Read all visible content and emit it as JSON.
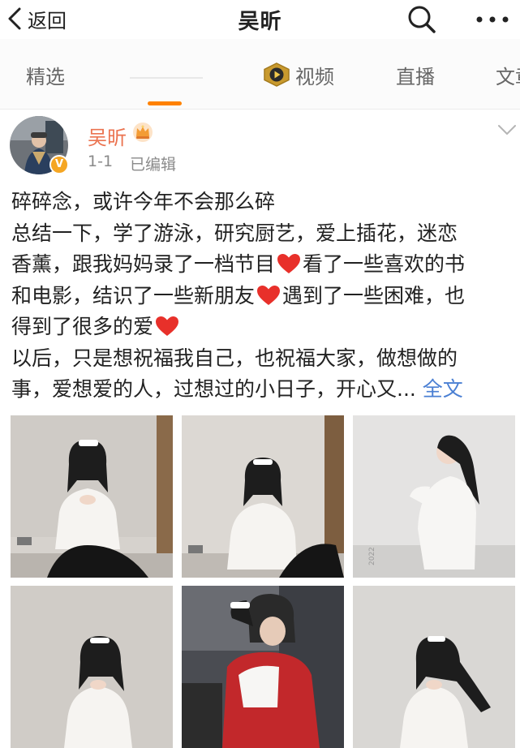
{
  "topbar": {
    "back_label": "返回",
    "title": "吴昕"
  },
  "tabs": [
    {
      "label": "精选"
    },
    {
      "label": "视频",
      "icon": "video-play-icon"
    },
    {
      "label": "直播"
    },
    {
      "label": "文章"
    }
  ],
  "post": {
    "author": "吴昕",
    "badge": "V",
    "time": "1-1",
    "edited": "已编辑",
    "lines": [
      "碎碎念，或许今年不会那么碎",
      "总结一下，学了游泳，研究厨艺，爱上插花，迷恋",
      "香薰，跟我妈妈录了一档节目",
      "看了一些喜欢的书",
      "和电影，结识了一些新朋友",
      "遇到了一些困难，也",
      "得到了很多的爱",
      "以后，只是想祝福我自己，也祝福大家，做想做的",
      "事，爱想爱的人，过想过的小日子，开心又..."
    ],
    "full_text_link": "全文"
  },
  "colors": {
    "accent": "#ff8200",
    "username": "#eb7350",
    "link": "#4a7fd3",
    "heart": "#e8302a"
  },
  "photos": [
    {
      "name": "photo-1",
      "stamp": ""
    },
    {
      "name": "photo-2",
      "stamp": ""
    },
    {
      "name": "photo-3",
      "stamp": "2022"
    },
    {
      "name": "photo-4",
      "stamp": ""
    },
    {
      "name": "photo-5",
      "stamp": ""
    },
    {
      "name": "photo-6",
      "stamp": ""
    }
  ]
}
